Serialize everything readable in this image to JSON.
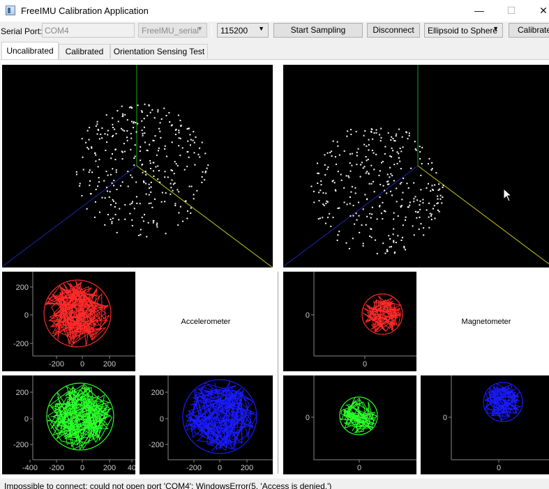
{
  "window": {
    "title": "FreeIMU Calibration Application",
    "minimize_glyph": "—",
    "maximize_glyph": "☐",
    "close_glyph": "✕"
  },
  "toolbar": {
    "serial_port_label": "Serial Port:",
    "serial_port_value": "COM4",
    "port_type": "FreeIMU_serial",
    "baud_rate": "115200",
    "start_sampling": "Start Sampling",
    "disconnect": "Disconnect",
    "calibration_mode": "Ellipsoid to Sphere",
    "calibrate": "Calibrate"
  },
  "tabs": [
    {
      "label": "Uncalibrated",
      "active": true
    },
    {
      "label": "Calibrated",
      "active": false
    },
    {
      "label": "Orientation Sensing Test",
      "active": false
    }
  ],
  "colors": {
    "x_series": "#ff2a2a",
    "y_series": "#2aff2a",
    "z_series": "#1a1aff",
    "axis_green": "#1aa81a",
    "axis_blue": "#1a2aa8",
    "axis_yellow": "#c8c81a",
    "points": "#ffffff"
  },
  "labels": {
    "accelerometer": "Accelerometer",
    "magnetometer": "Magnetometer"
  },
  "plots": {
    "acc_xy": {
      "x_ticks": [
        "-200",
        "0",
        "200"
      ],
      "y_ticks": [
        "200",
        "0",
        "-200"
      ],
      "center": [
        0,
        30
      ],
      "radius": 255
    },
    "acc_xz": {
      "x_ticks": [
        "-400",
        "-200",
        "0",
        "200",
        "40"
      ],
      "y_ticks": [
        "200",
        "0",
        "-200"
      ],
      "center": [
        0,
        0
      ],
      "radius": 255
    },
    "acc_yz": {
      "x_ticks": [
        "-200",
        "0",
        "200"
      ],
      "y_ticks": [
        "200",
        "0",
        "-200"
      ],
      "center": [
        0,
        0
      ],
      "radius": 255
    },
    "mag_xy": {
      "x_ticks": [
        "0"
      ],
      "y_ticks": [
        "0"
      ]
    },
    "mag_xz": {
      "x_ticks": [
        "0"
      ],
      "y_ticks": [
        "0"
      ]
    },
    "mag_yz": {
      "x_ticks": [
        "0"
      ],
      "y_ticks": [
        "0"
      ]
    }
  },
  "status": {
    "message": "Impossible to connect: could not open port 'COM4': WindowsError(5, 'Access is denied.')"
  }
}
